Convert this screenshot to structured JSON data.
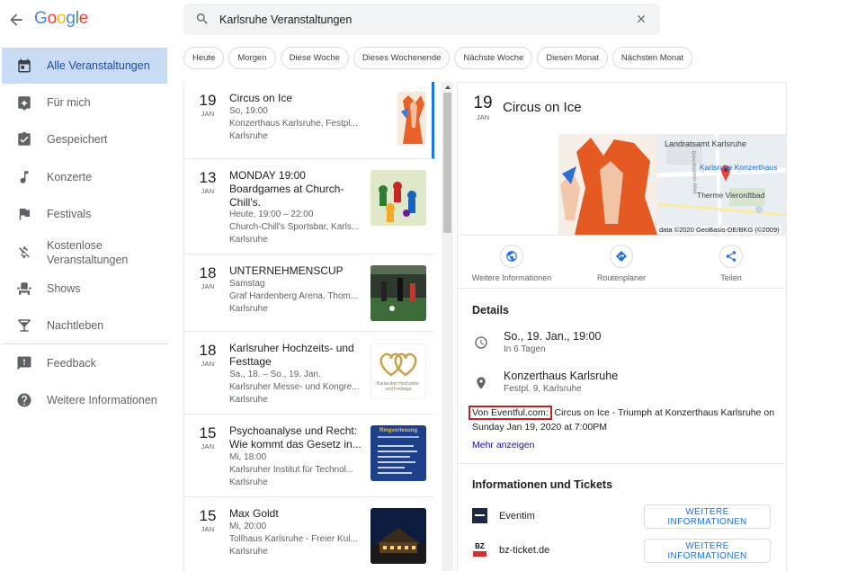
{
  "header": {
    "logo_text": "Google",
    "logo_colors": [
      "#4285f4",
      "#ea4335",
      "#fbbc05",
      "#4285f4",
      "#34a853",
      "#ea4335"
    ]
  },
  "sidebar": {
    "items": [
      {
        "label": "Alle Veranstaltungen",
        "icon": "calendar-icon",
        "active": true
      },
      {
        "label": "Für mich",
        "icon": "sparkle-plus-icon"
      },
      {
        "label": "Gespeichert",
        "icon": "calendar-check-icon"
      },
      {
        "label": "Konzerte",
        "icon": "music-note-icon"
      },
      {
        "label": "Festivals",
        "icon": "flag-icon"
      },
      {
        "label": "Kostenlose Veranstaltungen",
        "icon": "money-off-icon"
      },
      {
        "label": "Shows",
        "icon": "theater-seat-icon"
      },
      {
        "label": "Nachtleben",
        "icon": "cocktail-icon"
      },
      {
        "label": "Feedback",
        "icon": "feedback-icon"
      },
      {
        "label": "Weitere Informationen",
        "icon": "help-icon"
      }
    ]
  },
  "search": {
    "value": "Karlsruhe Veranstaltungen"
  },
  "chips": [
    "Heute",
    "Morgen",
    "Diese Woche",
    "Dieses Wochenende",
    "Nächste Woche",
    "Diesen Monat",
    "Nächsten Monat"
  ],
  "events": [
    {
      "day": "19",
      "month": "JAN",
      "title": "Circus on Ice",
      "lines": [
        "So, 19:00",
        "Konzerthaus Karlsruhe, Festpl...",
        "Karlsruhe"
      ]
    },
    {
      "day": "13",
      "month": "JAN",
      "title": "MONDAY 19:00 Boardgames at Church-Chill's.",
      "lines": [
        "Heute, 19:00 – 22:00",
        "Church-Chill's Sportsbar, Karls...",
        "Karlsruhe"
      ]
    },
    {
      "day": "18",
      "month": "JAN",
      "title": "UNTERNEHMENSCUP",
      "lines": [
        "Samstag",
        "Graf Hardenberg Arena, Thom...",
        "Karlsruhe"
      ]
    },
    {
      "day": "18",
      "month": "JAN",
      "title": "Karlsruher Hochzeits- und Festtage",
      "lines": [
        "Sa., 18. – So., 19. Jan.",
        "Karlsruher Messe- und Kongre...",
        "Karlsruhe"
      ]
    },
    {
      "day": "15",
      "month": "JAN",
      "title": "Psychoanalyse und Recht: Wie kommt das Gesetz in...",
      "lines": [
        "Mi, 18:00",
        "Karlsruher Institut für Technol...",
        "Karlsruhe"
      ]
    },
    {
      "day": "15",
      "month": "JAN",
      "title": "Max Goldt",
      "lines": [
        "Mi, 20:00",
        "Tollhaus Karlsruhe - Freier Kul...",
        "Karlsruhe"
      ]
    }
  ],
  "thumbnails": {
    "hochzeit_line1": "Karlsruher Hochzeits-",
    "hochzeit_line2": "und Festtage",
    "ringvorlesung_title": "Ringvorlesung"
  },
  "detail": {
    "day": "19",
    "month": "JAN",
    "title": "Circus on Ice",
    "map_labels": {
      "landratsamt": "Landratsamt Karlsruhe",
      "konzerthaus": "Karlsruhe Konzerthaus",
      "therme": "Therme Vierordtbad",
      "street": "Beiertheimer Allee"
    },
    "map_credit": "data ©2020 GeoBasis-DE/BKG (©2009)",
    "actions": [
      {
        "label": "Weitere Informationen",
        "icon": "globe-icon"
      },
      {
        "label": "Routenplaner",
        "icon": "directions-icon"
      },
      {
        "label": "Teilen",
        "icon": "share-icon"
      }
    ],
    "details_heading": "Details",
    "date_line": "So., 19. Jan., 19:00",
    "date_sub": "In 6 Tagen",
    "venue": "Konzerthaus Karlsruhe",
    "address": "Festpl. 9, Karlsruhe",
    "source": "Von Eventful.com:",
    "description": " Circus on Ice - Triumph at Konzerthaus Karlsruhe on Sunday Jan 19, 2020 at 7:00PM",
    "more": "Mehr anzeigen",
    "tickets_heading": "Informationen und Tickets",
    "tickets": [
      {
        "name": "Eventim",
        "button": "WEITERE INFORMATIONEN"
      },
      {
        "name": "bz-ticket.de",
        "button": "WEITERE INFORMATIONEN"
      }
    ],
    "bz_logo": "BZ"
  }
}
